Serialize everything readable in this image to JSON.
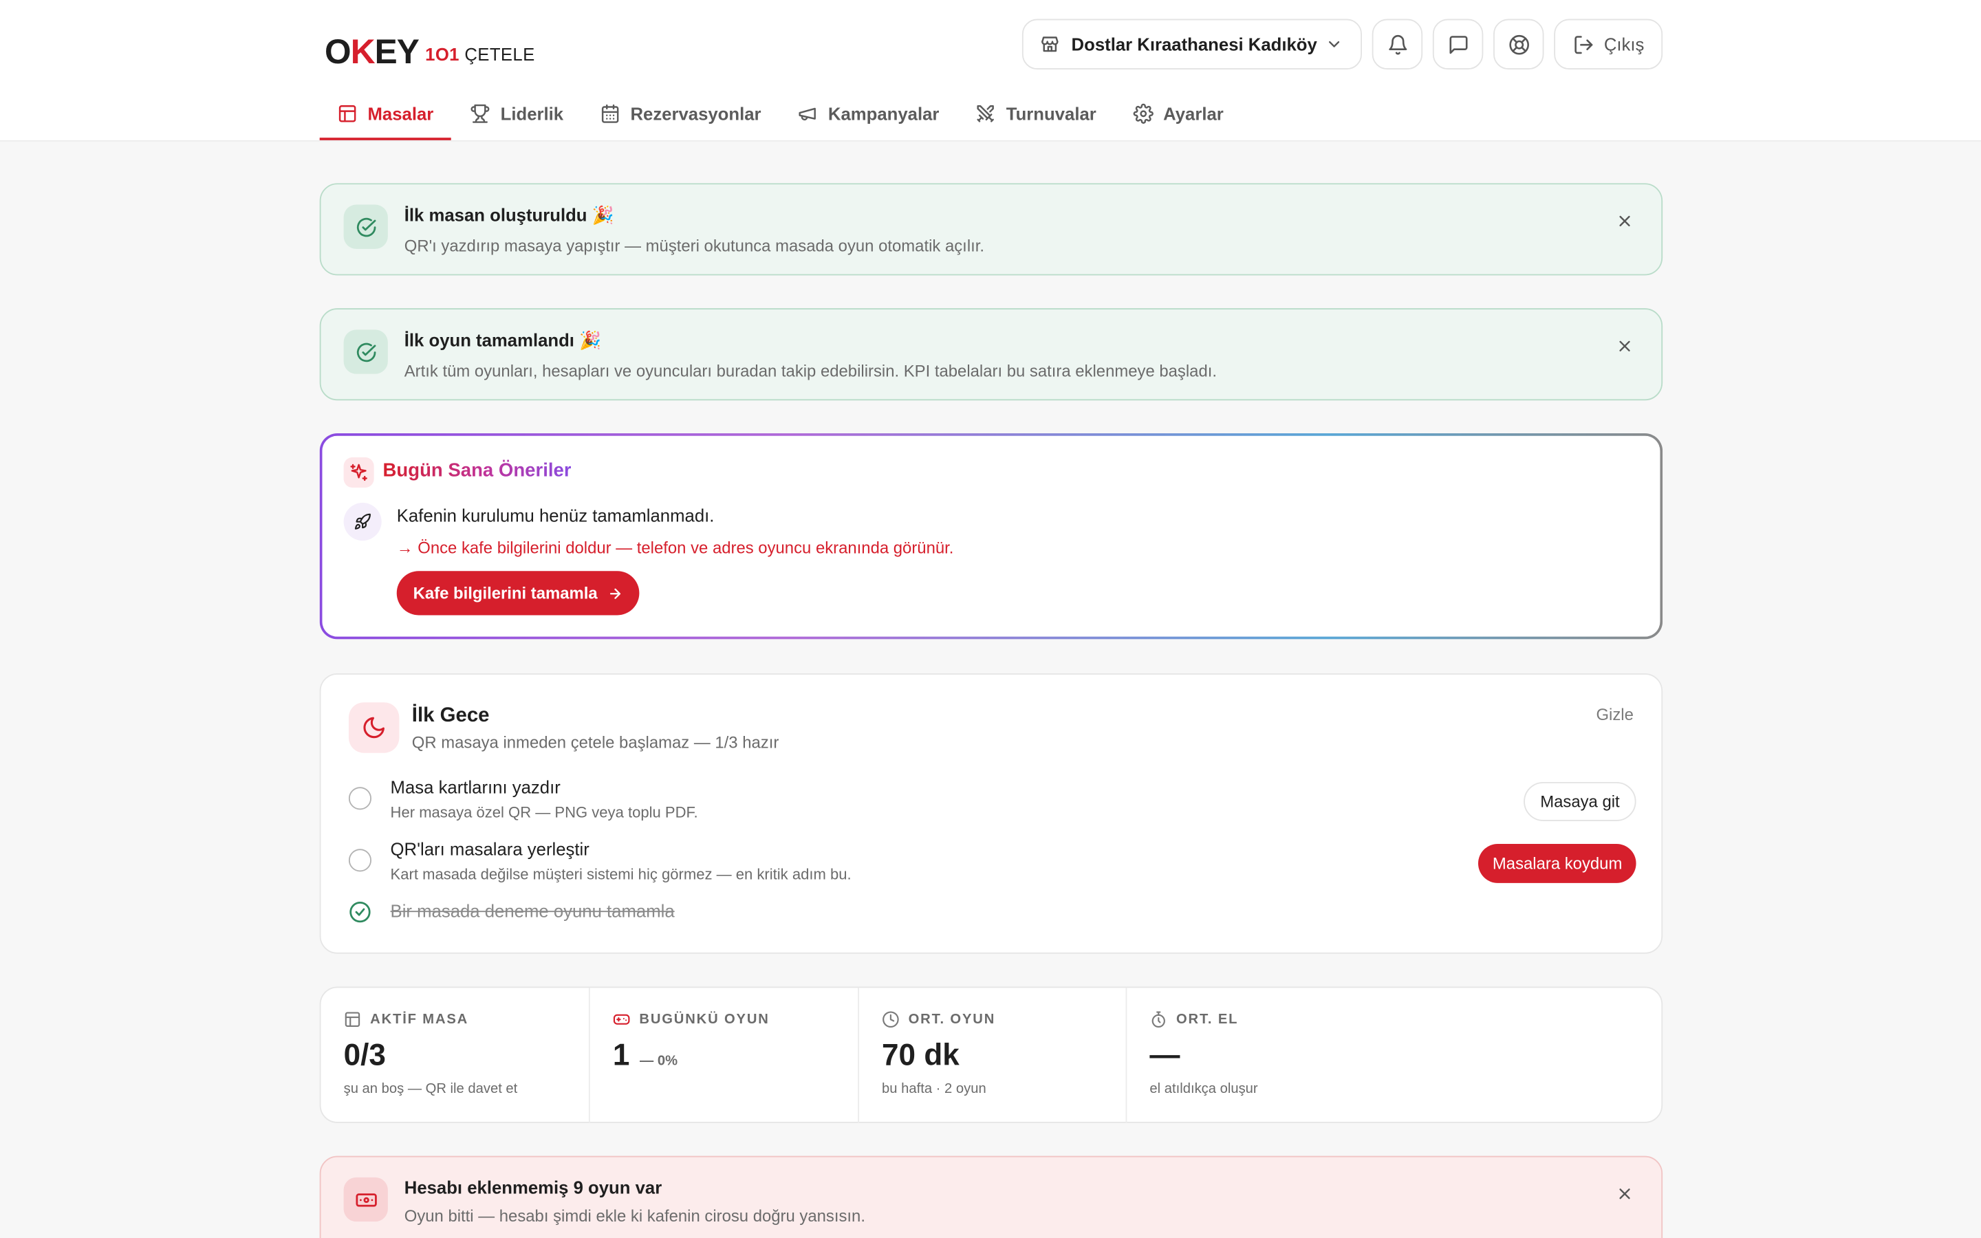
{
  "brand": {
    "logo_text_o": "O",
    "logo_text_k": "K",
    "logo_text_ey": "EY",
    "logo_tiles": "1O1",
    "logo_sub": "ÇETELE"
  },
  "header": {
    "cafe_name": "Dostlar Kıraathanesi Kadıköy",
    "logout_label": "Çıkış"
  },
  "nav": {
    "items": [
      {
        "label": "Masalar",
        "icon": "table-icon",
        "active": true
      },
      {
        "label": "Liderlik",
        "icon": "trophy-icon"
      },
      {
        "label": "Rezervasyonlar",
        "icon": "calendar-icon"
      },
      {
        "label": "Kampanyalar",
        "icon": "megaphone-icon"
      },
      {
        "label": "Turnuvalar",
        "icon": "swords-icon"
      },
      {
        "label": "Ayarlar",
        "icon": "gear-icon"
      }
    ]
  },
  "notices": [
    {
      "title": "İlk masan oluşturuldu 🎉",
      "desc": "QR'ı yazdırıp masaya yapıştır — müşteri okutunca masada oyun otomatik açılır."
    },
    {
      "title": "İlk oyun tamamlandı 🎉",
      "desc": "Artık tüm oyunları, hesapları ve oyuncuları buradan takip edebilirsin. KPI tabelaları bu satıra eklenmeye başladı."
    }
  ],
  "suggest": {
    "heading": "Bugün Sana Öneriler",
    "message": "Kafenin kurulumu henüz tamamlanmadı.",
    "hint": "→ Önce kafe bilgilerini doldur — telefon ve adres oyuncu ekranında görünür.",
    "cta": "Kafe bilgilerini tamamla"
  },
  "first_night": {
    "title": "İlk Gece",
    "desc": "QR masaya inmeden çetele başlamaz — 1/3 hazır",
    "hide_label": "Gizle",
    "tasks": [
      {
        "title": "Masa kartlarını yazdır",
        "desc": "Her masaya özel QR — PNG veya toplu PDF.",
        "button": "Masaya git",
        "done": false
      },
      {
        "title": "QR'ları masalara yerleştir",
        "desc": "Kart masada değilse müşteri sistemi hiç görmez — en kritik adım bu.",
        "button": "Masalara koydum",
        "done": false
      },
      {
        "title": "Bir masada deneme oyunu tamamla",
        "desc": "",
        "button": "",
        "done": true
      }
    ]
  },
  "kpis": [
    {
      "label": "AKTİF MASA",
      "icon": "table-icon",
      "value": "0/3",
      "delta": "",
      "sub": "şu an boş — QR ile davet et"
    },
    {
      "label": "BUGÜNKÜ OYUN",
      "icon": "gamepad-icon",
      "value": "1",
      "delta": "— 0%",
      "sub": ""
    },
    {
      "label": "ORT. OYUN",
      "icon": "clock-icon",
      "value": "70 dk",
      "delta": "",
      "sub": "bu hafta · 2 oyun"
    },
    {
      "label": "ORT. EL",
      "icon": "stopwatch-icon",
      "value": "—",
      "delta": "",
      "sub": "el atıldıkça oluşur"
    }
  ],
  "alert": {
    "title": "Hesabı eklenmemiş 9 oyun var",
    "desc": "Oyun bitti — hesabı şimdi ekle ki kafenin cirosu doğru yansısın."
  },
  "colors": {
    "brand_red": "#d61f2c",
    "success_bg": "#eef6f2",
    "success_icon": "#2f8a5f",
    "alert_bg": "#fcecec"
  }
}
